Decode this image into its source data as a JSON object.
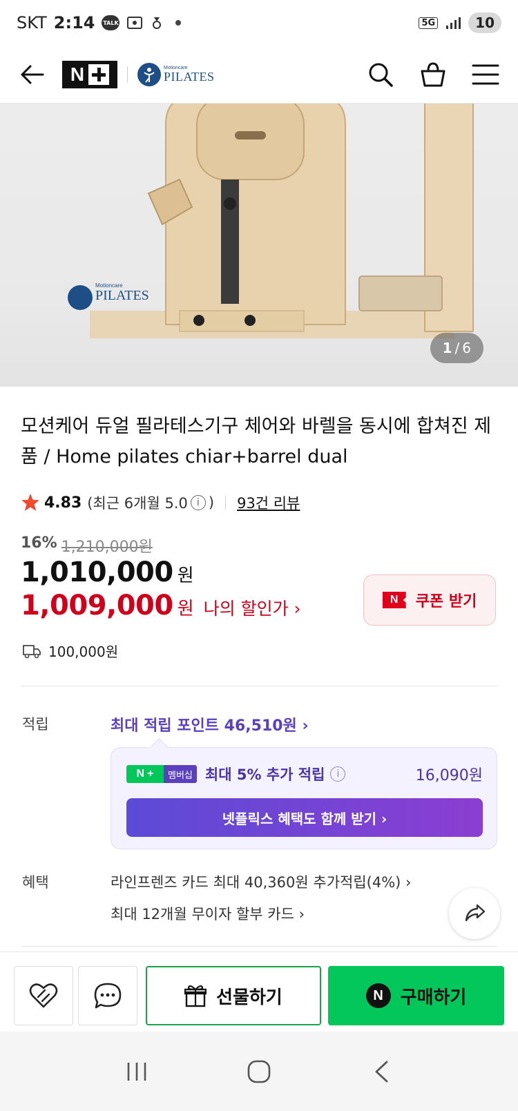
{
  "status_bar": {
    "carrier": "SKT",
    "time": "2:14",
    "talk_label": "TALK",
    "network": "5G",
    "battery": "10"
  },
  "header": {
    "nplus_n": "N",
    "brand_small": "Motioncare",
    "brand_big": "PILATES"
  },
  "gallery": {
    "current": "1",
    "total": "6",
    "separator": "/",
    "watermark_small": "Motioncare",
    "watermark_big": "PILATES"
  },
  "product": {
    "title": "모션케어 듀얼 필라테스기구 체어와 바렐을 동시에 합쳐진 제품 / Home pilates chiar+barrel dual",
    "rating": "4.83",
    "recent_rating": "(최근 6개월 5.0",
    "recent_close": ")",
    "review_count": "93건 리뷰"
  },
  "price": {
    "discount_pct": "16%",
    "original": "1,210,000원",
    "sale": "1,010,000",
    "sale_unit": "원",
    "my_price": "1,009,000",
    "my_unit": "원",
    "my_link": "나의 할인가 ›"
  },
  "coupon": {
    "badge": "N",
    "label": "쿠폰 받기"
  },
  "shipping": {
    "fee": "100,000원"
  },
  "points": {
    "label": "적립",
    "max": "최대 적립 포인트 46,510원 ›",
    "badge_n": "N",
    "badge_member": "멤버십",
    "extra": "최대 5% 추가 적립",
    "extra_amount": "16,090원",
    "netflix": "넷플릭스 혜택도 함께 받기 ›"
  },
  "benefits": {
    "label": "혜택",
    "item1": "라인프렌즈 카드 최대 40,360원 추가적립(4%) ›",
    "item2": "최대 12개월 무이자 할부 카드 ›"
  },
  "actions": {
    "gift": "선물하기",
    "buy_badge": "N",
    "buy": "구매하기"
  },
  "colors": {
    "naver_green": "#03c75a",
    "discount_red": "#d0021b",
    "points_purple": "#5a3fc0",
    "star": "#f04a2e"
  }
}
